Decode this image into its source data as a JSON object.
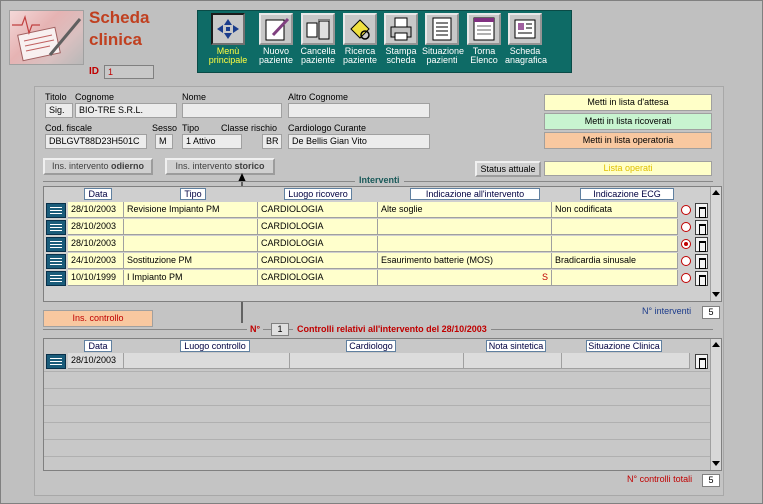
{
  "window": {
    "title": "Scheda\nclinica",
    "id_label": "ID",
    "id_value": "1"
  },
  "toolbar": [
    {
      "icon": "menu-grid-icon",
      "label": "Menù principale",
      "active": true
    },
    {
      "icon": "new-patient-icon",
      "label": "Nuovo paziente"
    },
    {
      "icon": "delete-patient-icon",
      "label": "Cancella paziente"
    },
    {
      "icon": "search-patient-icon",
      "label": "Ricerca paziente"
    },
    {
      "icon": "printer-icon",
      "label": "Stampa scheda"
    },
    {
      "icon": "patient-status-icon",
      "label": "Situazione pazienti"
    },
    {
      "icon": "list-icon",
      "label": "Torna Elenco"
    },
    {
      "icon": "registry-card-icon",
      "label": "Scheda anagrafica"
    }
  ],
  "patient": {
    "labels": {
      "titolo": "Titolo",
      "cognome": "Cognome",
      "nome": "Nome",
      "altro_cognome": "Altro Cognome",
      "cod_fiscale": "Cod. fiscale",
      "sesso": "Sesso",
      "tipo": "Tipo",
      "classe_rischio": "Classe rischio",
      "cardiologo": "Cardiologo Curante"
    },
    "titolo": "Sig.",
    "cognome": "BIO-TRE S.R.L.",
    "nome": "",
    "altro_cognome": "",
    "cod_fiscale": "DBLGVT88D23H501C",
    "sesso": "M",
    "tipo": "1 Attivo",
    "classe_rischio": "BR",
    "cardiologo": "De Bellis  Gian Vito"
  },
  "lists": {
    "attesa": "Metti in lista d'attesa",
    "ricoverati": "Metti in lista ricoverati",
    "operatoria": "Metti in lista operatoria"
  },
  "buttons": {
    "odierno_prefix": "Ins. intervento ",
    "odierno_bold": "odierno",
    "storico_prefix": "Ins. intervento ",
    "storico_bold": "storico",
    "status_label": "Status attuale",
    "status_value": "Lista operati",
    "controllo": "Ins. controllo"
  },
  "interventi": {
    "title": "Interventi",
    "headers": [
      "Data",
      "Tipo",
      "Luogo ricovero",
      "Indicazione all'intervento",
      "Indicazione ECG"
    ],
    "rows": [
      {
        "data": "28/10/2003",
        "tipo": "Revisione Impianto  PM",
        "luogo": "CARDIOLOGIA",
        "indicazione": "Alte soglie",
        "ecg": "Non codificata",
        "selected": false
      },
      {
        "data": "28/10/2003",
        "tipo": "",
        "luogo": "CARDIOLOGIA",
        "indicazione": "",
        "ecg": "",
        "selected": false
      },
      {
        "data": "28/10/2003",
        "tipo": "",
        "luogo": "CARDIOLOGIA",
        "indicazione": "",
        "ecg": "",
        "selected": true
      },
      {
        "data": "24/10/2003",
        "tipo": "Sostituzione  PM",
        "luogo": "CARDIOLOGIA",
        "indicazione": "Esaurimento batterie (MOS)",
        "ecg": "Bradicardia sinusale",
        "selected": false
      },
      {
        "data": "10/10/1999",
        "tipo": "I Impianto  PM",
        "luogo": "CARDIOLOGIA",
        "indicazione": "",
        "ecg": "",
        "marker": "S",
        "selected": false
      }
    ],
    "count_label": "N° interventi",
    "count_value": "5"
  },
  "controlli": {
    "n_label": "N°",
    "n_value": "1",
    "title": "Controlli relativi all'intervento del  28/10/2003",
    "headers": [
      "Data",
      "Luogo controllo",
      "Cardiologo",
      "Nota sintetica",
      "Situazione Clinica"
    ],
    "rows": [
      {
        "data": "28/10/2003",
        "luogo": "",
        "cardiologo": "",
        "nota": "",
        "situazione": ""
      }
    ],
    "count_label": "N° controlli totali",
    "count_value": "5"
  }
}
